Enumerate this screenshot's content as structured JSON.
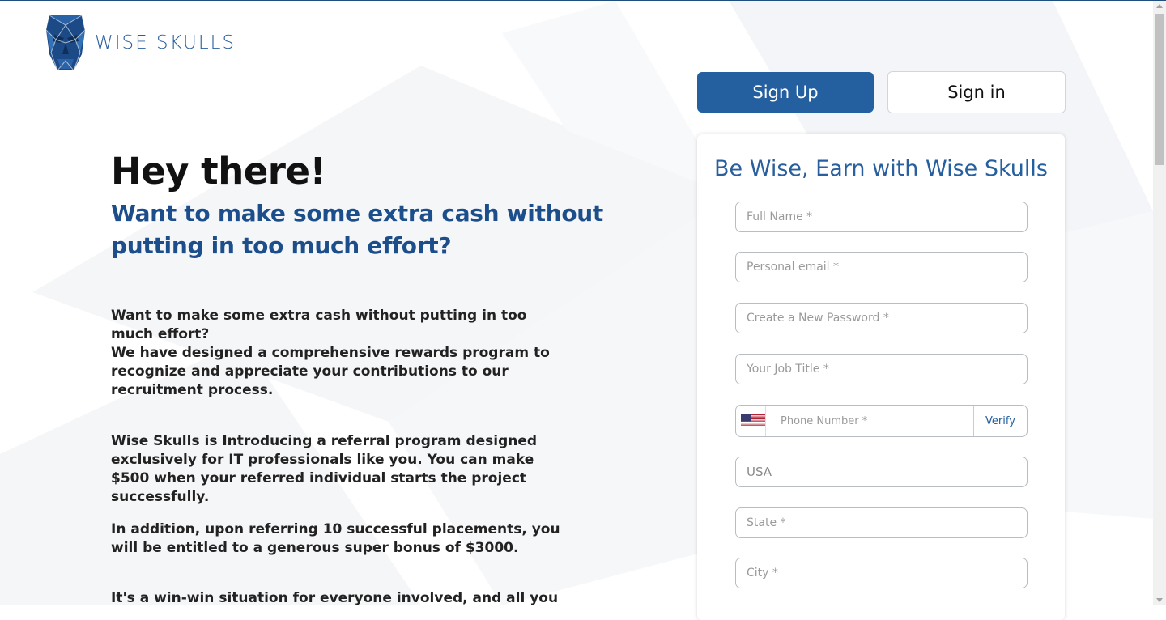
{
  "brand": {
    "name": "WISE SKULLS",
    "color": "#2a5f9e"
  },
  "hero": {
    "title": "Hey there!",
    "subtitle": "Want to make some extra cash without putting in too much effort?"
  },
  "paragraphs": [
    "Want to make some extra cash without putting in too much effort?\nWe have designed a comprehensive rewards program to recognize and appreciate your contributions to our recruitment process.",
    "Wise Skulls is Introducing a referral program designed exclusively for IT professionals like you. You can make $500 when your referred individual starts the project successfully.",
    "In addition, upon referring 10 successful placements, you will be entitled to a generous super bonus of $3000.",
    "It's a win-win situation for everyone involved, and all you"
  ],
  "auth_tabs": {
    "signup": "Sign Up",
    "signin": "Sign in"
  },
  "form": {
    "title_prefix": "Be Wise, Earn with ",
    "title_brand": "Wise Skulls",
    "full_name_placeholder": "Full Name *",
    "email_placeholder": "Personal email *",
    "password_placeholder": "Create a New Password *",
    "job_title_placeholder": "Your Job Title *",
    "phone_placeholder": "Phone Number *",
    "verify_label": "Verify",
    "country_value": "USA",
    "state_placeholder": "State *",
    "city_placeholder": "City *",
    "flag_icon": "us-flag-icon"
  },
  "colors": {
    "accent": "#245f9f",
    "heading_blue": "#1b4e8a"
  }
}
